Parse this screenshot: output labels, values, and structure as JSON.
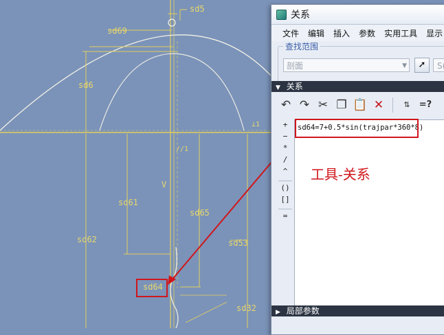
{
  "cad": {
    "dims": {
      "sd5": "sd5",
      "sd69": "sd69",
      "sd6": "sd6",
      "sd61": "sd61",
      "sd62": "sd62",
      "sd65": "sd65",
      "sd53": "sd53",
      "sd64": "sd64",
      "sd32": "sd32",
      "v": "V",
      "marker": "//1",
      "right_marker": "⊥1"
    }
  },
  "dialog": {
    "title": "关系",
    "menu": [
      "文件",
      "编辑",
      "插入",
      "参数",
      "实用工具",
      "显示"
    ],
    "scope": {
      "legend": "查找范围",
      "combo_value": "剖面",
      "combo2_value": "S("
    },
    "section_relations": "关系",
    "section_local_params": "局部参数",
    "side_buttons": [
      "+",
      "−",
      "*",
      "/",
      "^",
      "()",
      "[]",
      "="
    ],
    "relation_text": "sd64=7+0.5*sin(trajpar*360*8)"
  },
  "annotation": {
    "label": "工具-关系",
    "accent_color": "#d0161b"
  }
}
